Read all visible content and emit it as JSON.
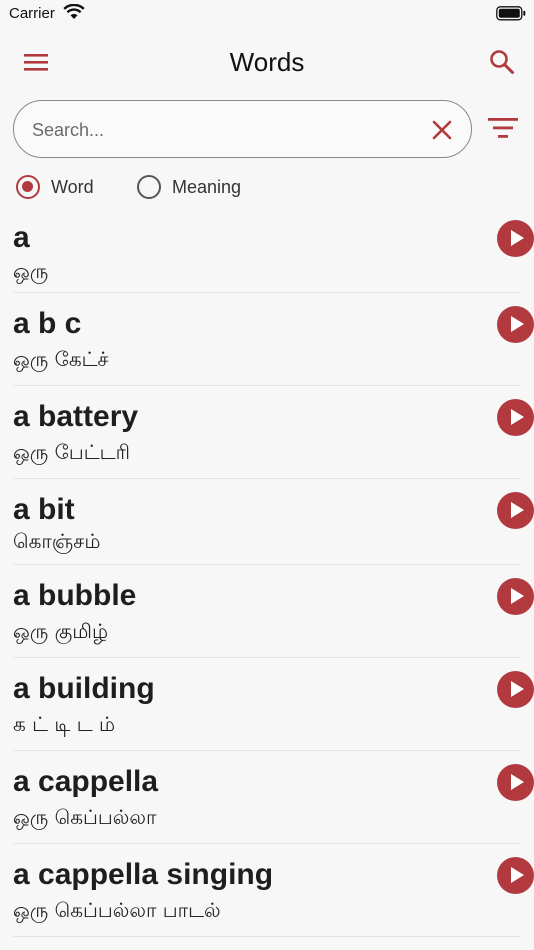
{
  "status": {
    "carrier": "Carrier"
  },
  "nav": {
    "title": "Words"
  },
  "search": {
    "placeholder": "Search..."
  },
  "radio": {
    "options": [
      {
        "label": "Word",
        "checked": true
      },
      {
        "label": "Meaning",
        "checked": false
      }
    ]
  },
  "words": [
    {
      "word": "a",
      "meaning": "ஒரு"
    },
    {
      "word": "a b c",
      "meaning": "ஒரு கேட்ச்"
    },
    {
      "word": "a battery",
      "meaning": "ஒரு பேட்டரி"
    },
    {
      "word": "a bit",
      "meaning": "கொஞ்சம்"
    },
    {
      "word": "a bubble",
      "meaning": "ஒரு குமிழ்"
    },
    {
      "word": "a building",
      "meaning": "க ட் டி ட ம்"
    },
    {
      "word": "a cappella",
      "meaning": "ஒரு கெப்பல்லா"
    },
    {
      "word": "a cappella singing",
      "meaning": "ஒரு கெப்பல்லா பாடல்"
    }
  ],
  "colors": {
    "accent": "#b23a3e",
    "background": "#f7f7f7"
  },
  "icons": {
    "menu": "hamburger-icon",
    "search": "search-icon",
    "clear": "close-icon",
    "filter": "filter-icon",
    "play": "play-icon"
  }
}
